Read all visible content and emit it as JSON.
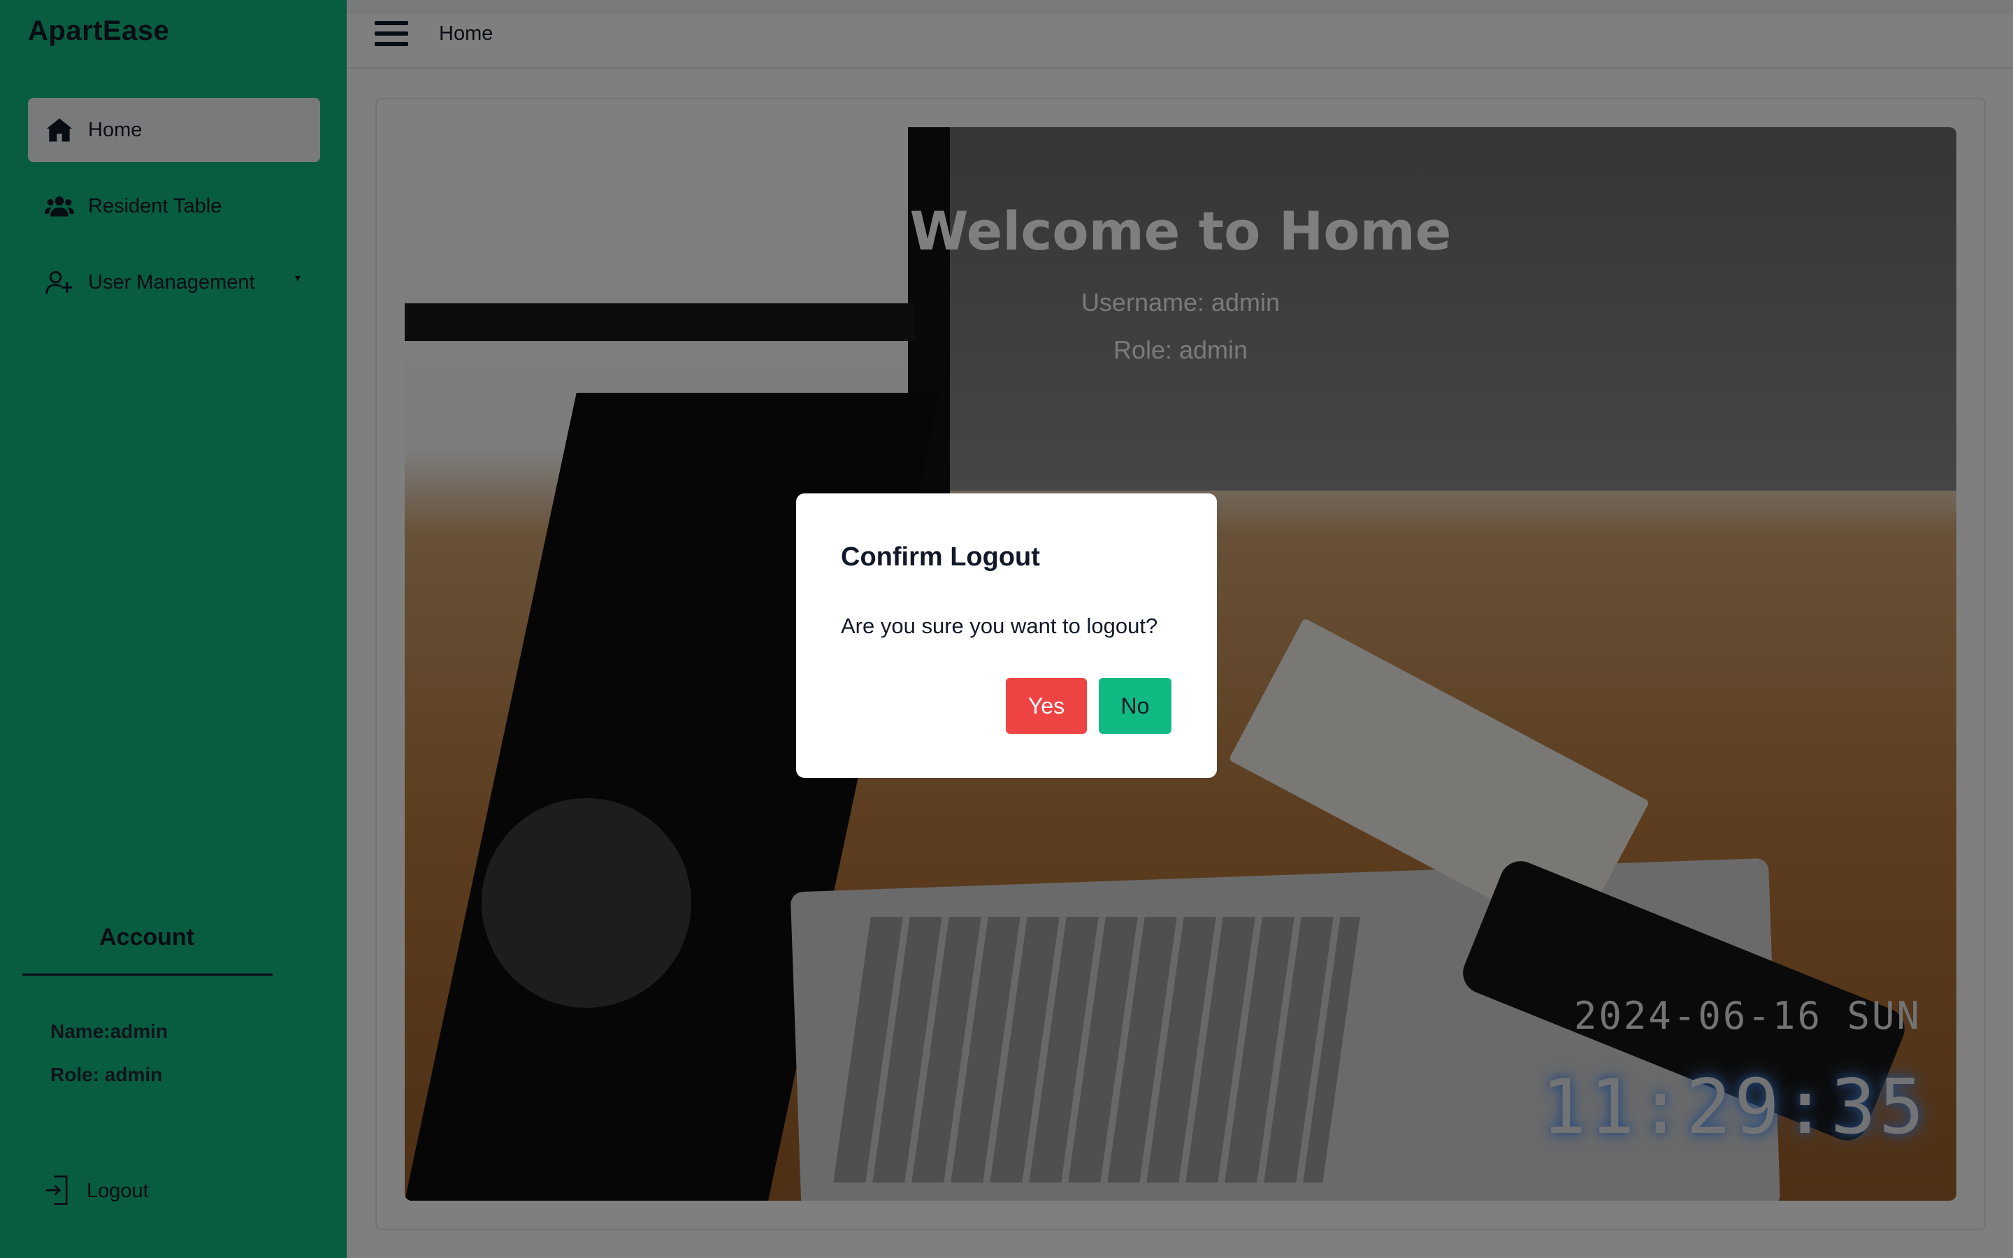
{
  "app": {
    "brand": "ApartEase"
  },
  "sidebar": {
    "items": [
      {
        "label": "Home",
        "icon": "home-icon",
        "active": true
      },
      {
        "label": "Resident Table",
        "icon": "users-icon"
      },
      {
        "label": "User Management",
        "icon": "user-plus-icon",
        "has_submenu": true
      }
    ],
    "account": {
      "title": "Account",
      "name_line": "Name:admin",
      "role_line": "Role: admin"
    },
    "logout_label": "Logout"
  },
  "topbar": {
    "breadcrumb": "Home"
  },
  "hero": {
    "title": "Welcome to Home",
    "username_line": "Username: admin",
    "role_line": "Role: admin",
    "date": "2024-06-16 SUN",
    "time": "11:29:35"
  },
  "modal": {
    "title": "Confirm Logout",
    "message": "Are you sure you want to logout?",
    "yes_label": "Yes",
    "no_label": "No"
  },
  "colors": {
    "accent": "#10b981",
    "danger": "#ef4444",
    "overlay": "rgba(0,0,0,0.5)"
  }
}
